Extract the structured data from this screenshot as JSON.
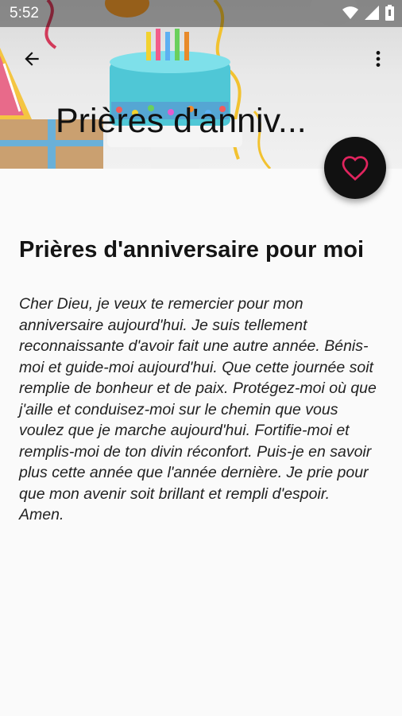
{
  "status_bar": {
    "time": "5:52"
  },
  "toolbar": {
    "collapsed_title": "Prières d'anniv..."
  },
  "article": {
    "title": "Prières d'anniversaire pour moi",
    "body": "Cher Dieu, je veux te remercier pour mon anniversaire aujourd'hui. Je suis tellement reconnaissante d'avoir fait une autre année. Bénis-moi et guide-moi aujourd'hui. Que cette journée soit remplie de bonheur et de paix. Protégez-moi où que j'aille et conduisez-moi sur le chemin que vous voulez que je marche aujourd'hui. Fortifie-moi et remplis-moi de ton divin réconfort. Puis-je en savoir plus cette année que l'année dernière. Je prie pour que mon avenir soit brillant et rempli d'espoir. Amen."
  },
  "colors": {
    "fab_bg": "#111111",
    "fab_heart": "#e0245e",
    "page_bg": "#fafafa"
  },
  "icons": [
    "back-arrow-icon",
    "more-vert-icon",
    "heart-icon",
    "wifi-icon",
    "signal-icon",
    "battery-icon"
  ]
}
